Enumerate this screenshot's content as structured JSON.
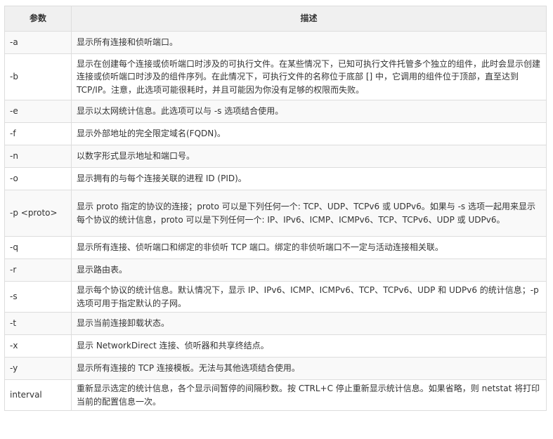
{
  "headers": {
    "param": "参数",
    "desc": "描述"
  },
  "rows": [
    {
      "param": "-a",
      "desc": "显示所有连接和侦听端口。",
      "lines": 1
    },
    {
      "param": "-b",
      "desc": "显示在创建每个连接或侦听端口时涉及的可执行文件。在某些情况下，已知可执行文件托管多个独立的组件，此时会显示创建连接或侦听端口时涉及的组件序列。在此情况下，可执行文件的名称位于底部 [] 中，它调用的组件位于顶部，直至达到 TCP/IP。注意，此选项可能很耗时，并且可能因为你没有足够的权限而失败。",
      "lines": 3
    },
    {
      "param": "-e",
      "desc": "显示以太网统计信息。此选项可以与 -s 选项结合使用。",
      "lines": 1
    },
    {
      "param": "-f",
      "desc": "显示外部地址的完全限定域名(FQDN)。",
      "lines": 1
    },
    {
      "param": "-n",
      "desc": "以数字形式显示地址和端口号。",
      "lines": 1
    },
    {
      "param": "-o",
      "desc": "显示拥有的与每个连接关联的进程 ID (PID)。",
      "lines": 1
    },
    {
      "param": "-p <proto>",
      "desc": "显示 proto 指定的协议的连接；proto 可以是下列任何一个: TCP、UDP、TCPv6 或 UDPv6。如果与 -s 选项一起用来显示每个协议的统计信息，proto 可以是下列任何一个: IP、IPv6、ICMP、ICMPv6、TCP、TCPv6、UDP 或 UDPv6。",
      "lines": 3
    },
    {
      "param": "-q",
      "desc": "显示所有连接、侦听端口和绑定的非侦听 TCP 端口。绑定的非侦听端口不一定与活动连接相关联。",
      "lines": 1
    },
    {
      "param": "-r",
      "desc": "显示路由表。",
      "lines": 1
    },
    {
      "param": "-s",
      "desc": "显示每个协议的统计信息。默认情况下，显示 IP、IPv6、ICMP、ICMPv6、TCP、TCPv6、UDP 和 UDPv6 的统计信息；-p 选项可用于指定默认的子网。",
      "lines": 2
    },
    {
      "param": "-t",
      "desc": "显示当前连接卸载状态。",
      "lines": 1
    },
    {
      "param": "-x",
      "desc": "显示 NetworkDirect 连接、侦听器和共享终结点。",
      "lines": 1
    },
    {
      "param": "-y",
      "desc": "显示所有连接的 TCP 连接模板。无法与其他选项结合使用。",
      "lines": 1
    },
    {
      "param": "interval",
      "desc": "重新显示选定的统计信息，各个显示间暂停的间隔秒数。按 CTRL+C 停止重新显示统计信息。如果省略，则 netstat 将打印当前的配置信息一次。",
      "lines": 2
    }
  ]
}
